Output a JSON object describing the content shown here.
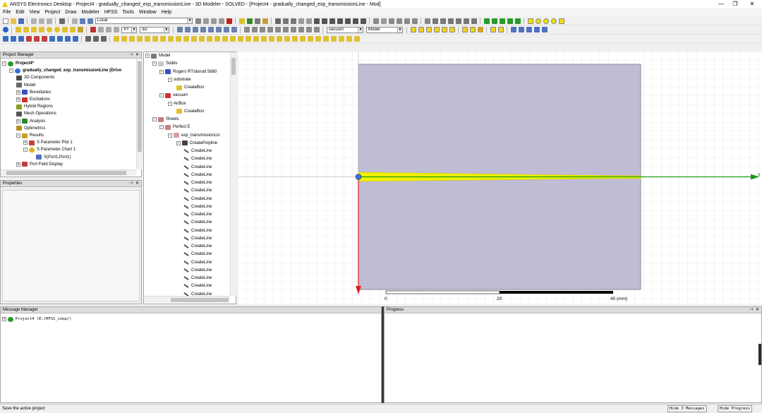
{
  "window": {
    "title": "ANSYS Electronics Desktop - Project4 - gradually_changed_exp_transmissionLine - 3D Modeler - SOLVED - [Project4 - gradually_changed_exp_transmissionLine - Mod]",
    "minimize": "—",
    "restore": "❐",
    "close": "✕"
  },
  "menu": [
    "File",
    "Edit",
    "View",
    "Project",
    "Draw",
    "Modeler",
    "HFSS",
    "Tools",
    "Window",
    "Help"
  ],
  "toolbar": {
    "coord_system": "Local",
    "plane": "XY",
    "mode": "3D",
    "material": "vacuum",
    "model_filter": "Model"
  },
  "project_manager": {
    "title": "Project Manager",
    "items": [
      {
        "label": "Project4*",
        "bold": true
      },
      {
        "label": "gradually_changed_exp_transmissionLine (Drive",
        "bold": true
      },
      {
        "label": "3D Components"
      },
      {
        "label": "Model"
      },
      {
        "label": "Boundaries"
      },
      {
        "label": "Excitations"
      },
      {
        "label": "Hybrid Regions"
      },
      {
        "label": "Mesh Operations"
      },
      {
        "label": "Analysis"
      },
      {
        "label": "Optimetrics"
      },
      {
        "label": "Results"
      },
      {
        "label": "S Parameter Plot 1"
      },
      {
        "label": "S Parameter Chart 1"
      },
      {
        "label": "S(Port1,Port1)"
      },
      {
        "label": "Port Field Display"
      }
    ]
  },
  "properties": {
    "title": "Properties"
  },
  "model_tree": {
    "items": [
      {
        "label": "Model"
      },
      {
        "label": "Solids"
      },
      {
        "label": "Rogers RT/duroid 5880"
      },
      {
        "label": "substrate"
      },
      {
        "label": "CreateBox"
      },
      {
        "label": "vacuum"
      },
      {
        "label": "AirBox"
      },
      {
        "label": "CreateBox"
      },
      {
        "label": "Sheets"
      },
      {
        "label": "Perfect E"
      },
      {
        "label": "exp_transmissionLin"
      },
      {
        "label": "CreatePolyline"
      },
      {
        "label": "CreateLine"
      },
      {
        "label": "CreateLine"
      },
      {
        "label": "CreateLine"
      },
      {
        "label": "CreateLine"
      },
      {
        "label": "CreateLine"
      },
      {
        "label": "CreateLine"
      },
      {
        "label": "CreateLine"
      },
      {
        "label": "CreateLine"
      },
      {
        "label": "CreateLine"
      },
      {
        "label": "CreateLine"
      },
      {
        "label": "CreateLine"
      },
      {
        "label": "CreateLine"
      },
      {
        "label": "CreateLine"
      },
      {
        "label": "CreateLine"
      },
      {
        "label": "CreateLine"
      },
      {
        "label": "CreateLine"
      },
      {
        "label": "CreateLine"
      },
      {
        "label": "CreateLine"
      },
      {
        "label": "CreateLine"
      }
    ]
  },
  "viewport": {
    "axis_y_label": "y",
    "scale": {
      "tick_0": "0",
      "tick_20": "20",
      "tick_40": "40 (mm)"
    },
    "colors": {
      "substrate": "#c0bcd4",
      "trace": "#f0f000",
      "axis_y": "#1a9a1a",
      "axis_x": "#e02020"
    }
  },
  "message_manager": {
    "title": "Message Manager",
    "entry": "Project4 (E:/HFSS_simu/)"
  },
  "progress": {
    "title": "Progress"
  },
  "status": {
    "text": "Save the active project",
    "hide_messages": "Hide 3 Messages",
    "hide_progress": "Hide Progress"
  }
}
